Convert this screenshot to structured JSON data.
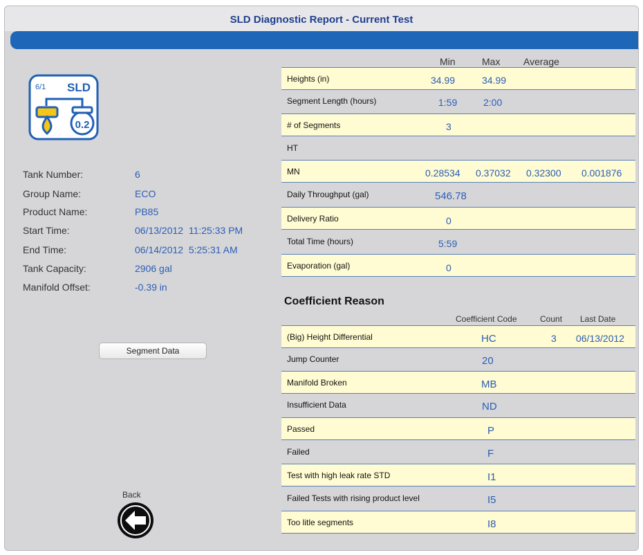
{
  "window": {
    "title": "SLD Diagnostic Report - Current Test"
  },
  "logo": {
    "badge": "6/1",
    "brand": "SLD",
    "value": "0.2",
    "icon": "sld-tank-icon"
  },
  "tank_info": [
    {
      "label": "Tank Number:",
      "value": "6"
    },
    {
      "label": "Group Name:",
      "value": "ECO"
    },
    {
      "label": "Product Name:",
      "value": "PB85"
    },
    {
      "label": "Start Time:",
      "value": "06/13/2012  11:25:33 PM"
    },
    {
      "label": "End Time:",
      "value": "06/14/2012  5:25:31 AM"
    },
    {
      "label": "Tank Capacity:",
      "value": "2906 gal"
    },
    {
      "label": "Manifold Offset:",
      "value": "-0.39 in"
    }
  ],
  "buttons": {
    "segment_data": "Segment Data",
    "back": "Back",
    "back_icon": "arrow-left-icon"
  },
  "stats": {
    "headers": {
      "min": "Min",
      "max": "Max",
      "average": "Average"
    },
    "rows": [
      {
        "label": "Heights (in)",
        "min": "34.99",
        "max": "34.99"
      },
      {
        "label": "Segment Length (hours)",
        "min": "1:59",
        "max": "2:00"
      },
      {
        "label": "# of Segments",
        "min": "3"
      },
      {
        "label": "HT"
      },
      {
        "label": "MN",
        "min": "0.28534",
        "max": "0.37032",
        "average": "0.32300",
        "extra": "0.001876"
      },
      {
        "label": "Daily Throughput (gal)",
        "min": "546.78"
      },
      {
        "label": "Delivery Ratio",
        "min": "0"
      },
      {
        "label": "Total Time (hours)",
        "min": "5:59"
      },
      {
        "label": "Evaporation (gal)",
        "min": "0"
      }
    ]
  },
  "coefficient": {
    "title": "Coefficient Reason",
    "headers": {
      "code": "Coefficient Code",
      "count": "Count",
      "last_date": "Last Date"
    },
    "rows": [
      {
        "label": "(Big) Height Differential",
        "code": "HC",
        "count": "3",
        "last_date": "06/13/2012"
      },
      {
        "label": "Jump Counter",
        "code": "20"
      },
      {
        "label": "Manifold Broken",
        "code": "MB"
      },
      {
        "label": "Insufficient Data",
        "code": "ND"
      },
      {
        "label": "Passed",
        "code": "P"
      },
      {
        "label": "Failed",
        "code": "F"
      },
      {
        "label": "Test with high leak rate STD",
        "code": "I1"
      },
      {
        "label": "Failed Tests with rising product level",
        "code": "I5"
      },
      {
        "label": "Too litle segments",
        "code": "I8"
      }
    ]
  },
  "colors": {
    "accent_blue": "#1e66b7",
    "value_blue": "#2a5db6",
    "row_highlight": "#fffbd2",
    "panel_gray": "#d6d6d8"
  }
}
